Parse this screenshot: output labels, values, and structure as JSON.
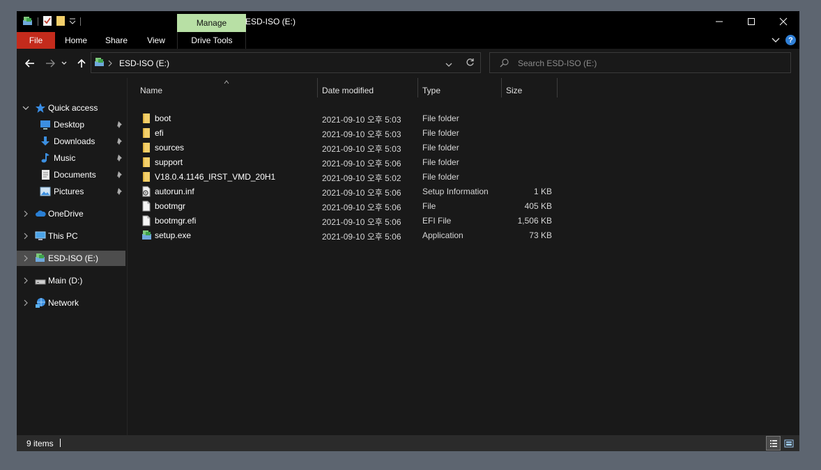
{
  "window": {
    "title": "ESD-ISO (E:)",
    "manage_tab": "Manage",
    "controls": {
      "minimize": "—",
      "maximize": "☐",
      "close": "✕"
    }
  },
  "ribbon": {
    "tabs": [
      "File",
      "Home",
      "Share",
      "View",
      "Drive Tools"
    ],
    "help_icon": "?"
  },
  "address": {
    "location": "ESD-ISO (E:)",
    "search_placeholder": "Search ESD-ISO (E:)"
  },
  "sidebar": {
    "quick_access": "Quick access",
    "quick_items": [
      "Desktop",
      "Downloads",
      "Music",
      "Documents",
      "Pictures"
    ],
    "locations": [
      "OneDrive",
      "This PC",
      "ESD-ISO (E:)",
      "Main (D:)",
      "Network"
    ],
    "selected": "ESD-ISO (E:)"
  },
  "columns": [
    "Name",
    "Date modified",
    "Type",
    "Size"
  ],
  "files": [
    {
      "name": "boot",
      "date": "2021-09-10 오후 5:03",
      "type": "File folder",
      "size": "",
      "icon": "folder-icon"
    },
    {
      "name": "efi",
      "date": "2021-09-10 오후 5:03",
      "type": "File folder",
      "size": "",
      "icon": "folder-icon"
    },
    {
      "name": "sources",
      "date": "2021-09-10 오후 5:03",
      "type": "File folder",
      "size": "",
      "icon": "folder-icon"
    },
    {
      "name": "support",
      "date": "2021-09-10 오후 5:06",
      "type": "File folder",
      "size": "",
      "icon": "folder-icon"
    },
    {
      "name": "V18.0.4.1146_IRST_VMD_20H1",
      "date": "2021-09-10 오후 5:02",
      "type": "File folder",
      "size": "",
      "icon": "folder-icon"
    },
    {
      "name": "autorun.inf",
      "date": "2021-09-10 오후 5:06",
      "type": "Setup Information",
      "size": "1 KB",
      "icon": "settings-file-icon"
    },
    {
      "name": "bootmgr",
      "date": "2021-09-10 오후 5:06",
      "type": "File",
      "size": "405 KB",
      "icon": "file-icon"
    },
    {
      "name": "bootmgr.efi",
      "date": "2021-09-10 오후 5:06",
      "type": "EFI File",
      "size": "1,506 KB",
      "icon": "file-icon"
    },
    {
      "name": "setup.exe",
      "date": "2021-09-10 오후 5:06",
      "type": "Application",
      "size": "73 KB",
      "icon": "setup-app-icon"
    }
  ],
  "status": {
    "item_count": "9 items"
  },
  "colors": {
    "file_tab": "#c42b1c",
    "manage_tab": "#b8e0a5",
    "selected_nav": "#4d4d4d",
    "folder": "#f3cf6a"
  }
}
